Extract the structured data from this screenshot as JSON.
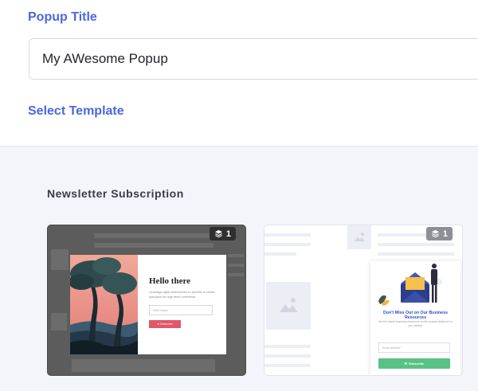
{
  "form": {
    "title_label": "Popup Title",
    "title_value": "My AWesome Popup",
    "template_label": "Select Template"
  },
  "section": {
    "heading": "Newsletter Subscription"
  },
  "templates": [
    {
      "badge_count": "1",
      "preview": {
        "heading": "Hello there",
        "description": "Leverage agile frameworks to provide a robust synopsis for high level overviews",
        "input_placeholder": "Enter Name",
        "button_label": "Subscribe"
      }
    },
    {
      "badge_count": "1",
      "preview": {
        "heading": "Don't Miss Out on Our Business Resources",
        "description": "Get the latest business resources on the market delivered to you weekly.",
        "input_placeholder": "Email address*",
        "button_label": "Subscribe"
      }
    }
  ],
  "colors": {
    "accent": "#4c66dd",
    "subscribe_red": "#e1576b",
    "subscribe_green": "#58c285",
    "light_heading_blue": "#2c4fc4"
  },
  "icons": {
    "badge": "layers-icon",
    "ghost_image": "image-placeholder-icon"
  }
}
